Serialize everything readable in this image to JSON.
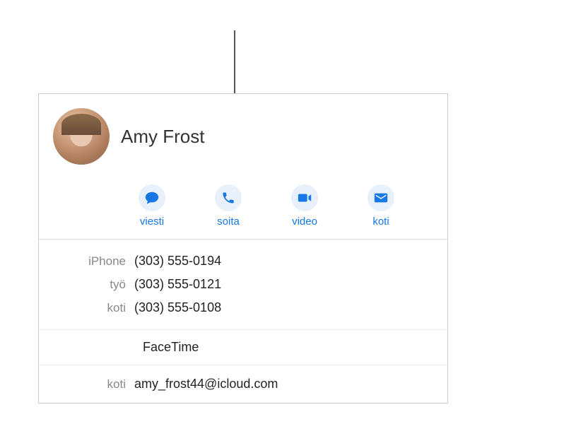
{
  "contact": {
    "name": "Amy Frost"
  },
  "actions": {
    "message": "viesti",
    "call": "soita",
    "video": "video",
    "mail": "koti"
  },
  "phones": [
    {
      "label": "iPhone",
      "value": "(303) 555-0194"
    },
    {
      "label": "työ",
      "value": "(303) 555-0121"
    },
    {
      "label": "koti",
      "value": "(303) 555-0108"
    }
  ],
  "facetime": {
    "title": "FaceTime"
  },
  "emails": [
    {
      "label": "koti",
      "value": "amy_frost44@icloud.com"
    }
  ]
}
